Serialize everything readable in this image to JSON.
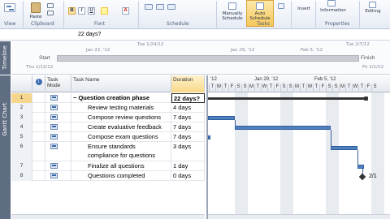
{
  "ribbon": {
    "groups": [
      "View",
      "Clipboard",
      "Font",
      "Schedule",
      "Tasks",
      "Properties"
    ],
    "paste_label": "Paste",
    "manually_schedule_label": [
      "Manually",
      "Schedule"
    ],
    "auto_schedule_label": [
      "Auto",
      "Schedule"
    ],
    "insert_label": "Insert",
    "information_label": "Information",
    "editing_label": "Editing"
  },
  "entry_bar": {
    "value": "22 days?"
  },
  "timeline": {
    "side_label": "Timeline",
    "top_dates": [
      "Tue 1/24/12",
      "Jan 22, '12",
      "Jan 29, '12",
      "Feb 5, '12",
      "Tue 2/7/12"
    ],
    "start_label": "Start",
    "start_date": "Thu 1/12/12",
    "finish_label": "Finish",
    "finish_date": "Fri 2/1/12"
  },
  "gantt_side_label": "Gantt Chart",
  "table": {
    "columns": {
      "mode": "Task Mode",
      "name": "Task Name",
      "duration": "Duration"
    },
    "rows": [
      {
        "id": "1",
        "name": "Question creation phase",
        "duration": "22 days?"
      },
      {
        "id": "2",
        "name": "Review testing materials",
        "duration": "4 days"
      },
      {
        "id": "3",
        "name": "Compose review questions",
        "duration": "7 days"
      },
      {
        "id": "4",
        "name": "Create evaluative feedback",
        "duration": "7 days"
      },
      {
        "id": "5",
        "name": "Compose exam questions",
        "duration": "7 days"
      },
      {
        "id": "6",
        "name": "Ensure standards",
        "name2": "compliance for questions",
        "duration": "3 days"
      },
      {
        "id": "7",
        "name": "Finalize all questions",
        "duration": "1 day"
      },
      {
        "id": "8",
        "name": "Questions completed",
        "duration": "0 days"
      }
    ]
  },
  "chart": {
    "week_labels": [
      "'12",
      "Jan 29, '12",
      "Feb 5, '12"
    ],
    "day_letters": [
      "T",
      "W",
      "T",
      "F",
      "S",
      "S",
      "M",
      "T",
      "W",
      "T",
      "F",
      "S",
      "S",
      "M",
      "T",
      "W",
      "T",
      "F",
      "S",
      "S",
      "M",
      "T",
      "W",
      "T",
      "F",
      "S"
    ],
    "milestone_label": "2/1"
  }
}
